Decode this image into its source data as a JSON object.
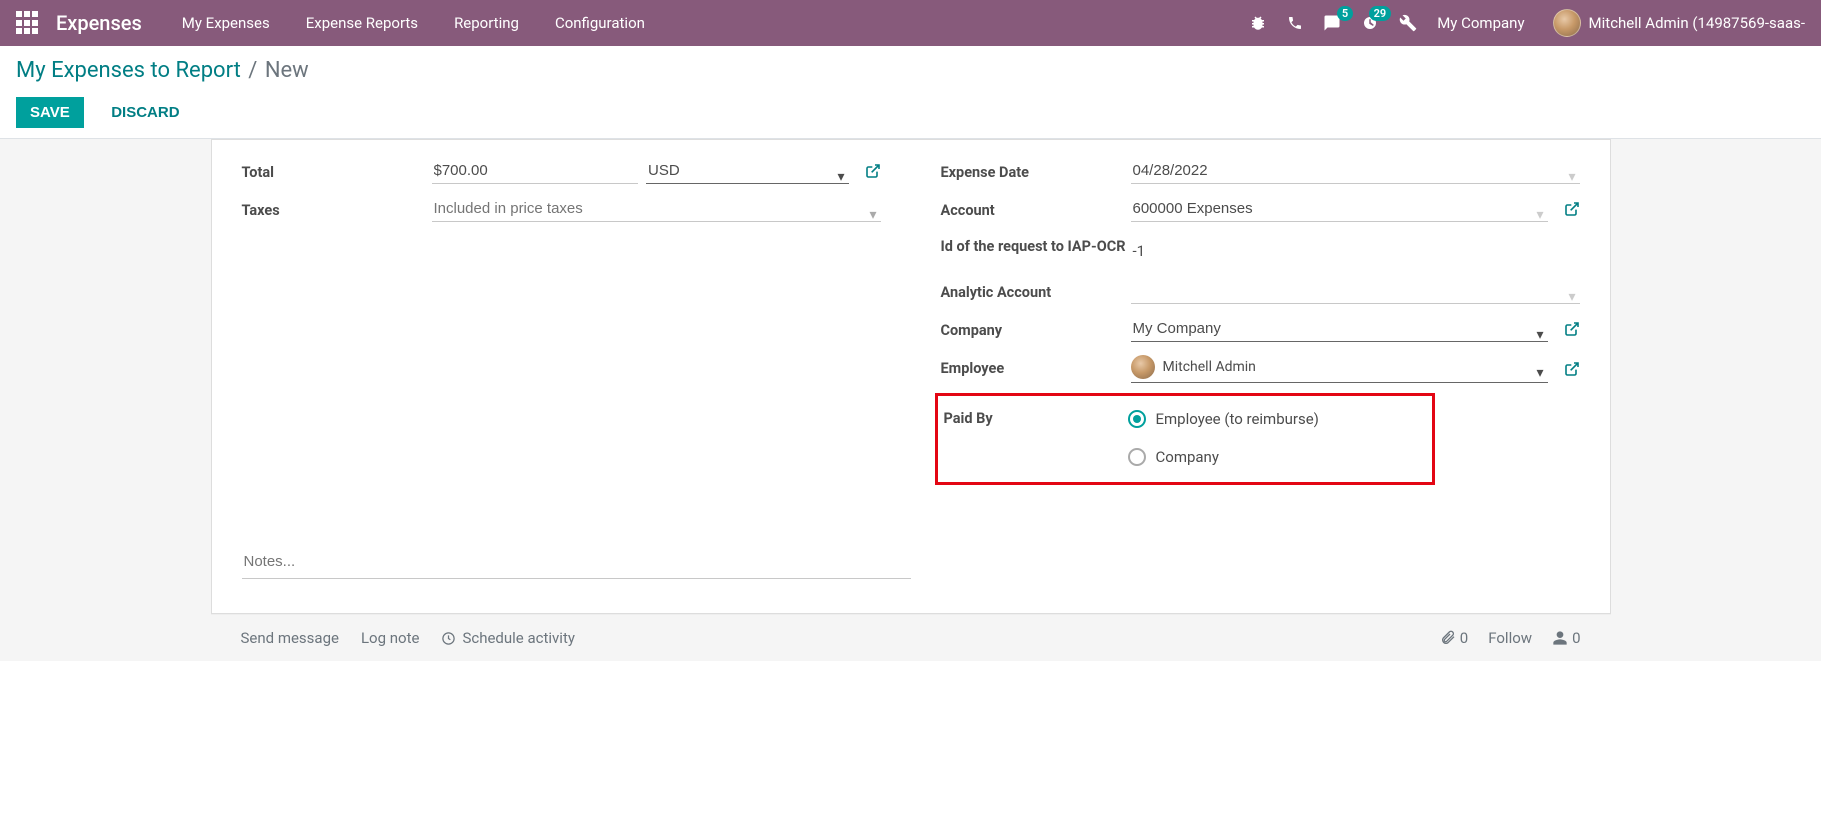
{
  "navbar": {
    "brand": "Expenses",
    "menu": [
      "My Expenses",
      "Expense Reports",
      "Reporting",
      "Configuration"
    ],
    "messages_badge": "5",
    "activities_badge": "29",
    "company": "My Company",
    "user": "Mitchell Admin (14987569-saas-"
  },
  "breadcrumb": {
    "parent": "My Expenses to Report",
    "current": "New"
  },
  "buttons": {
    "save": "Save",
    "discard": "Discard"
  },
  "left": {
    "total_label": "Total",
    "total_value": "$700.00",
    "currency": "USD",
    "taxes_label": "Taxes",
    "taxes_placeholder": "Included in price taxes"
  },
  "right": {
    "date_label": "Expense Date",
    "date_value": "04/28/2022",
    "account_label": "Account",
    "account_value": "600000 Expenses",
    "iap_label": "Id of the request to IAP-OCR",
    "iap_value": "-1",
    "analytic_label": "Analytic Account",
    "analytic_value": "",
    "company_label": "Company",
    "company_value": "My Company",
    "employee_label": "Employee",
    "employee_value": "Mitchell Admin",
    "paidby_label": "Paid By",
    "paidby_opt1": "Employee (to reimburse)",
    "paidby_opt2": "Company"
  },
  "notes_placeholder": "Notes...",
  "chatter": {
    "send": "Send message",
    "log": "Log note",
    "schedule": "Schedule activity",
    "attach_count": "0",
    "follow": "Follow",
    "followers": "0"
  }
}
